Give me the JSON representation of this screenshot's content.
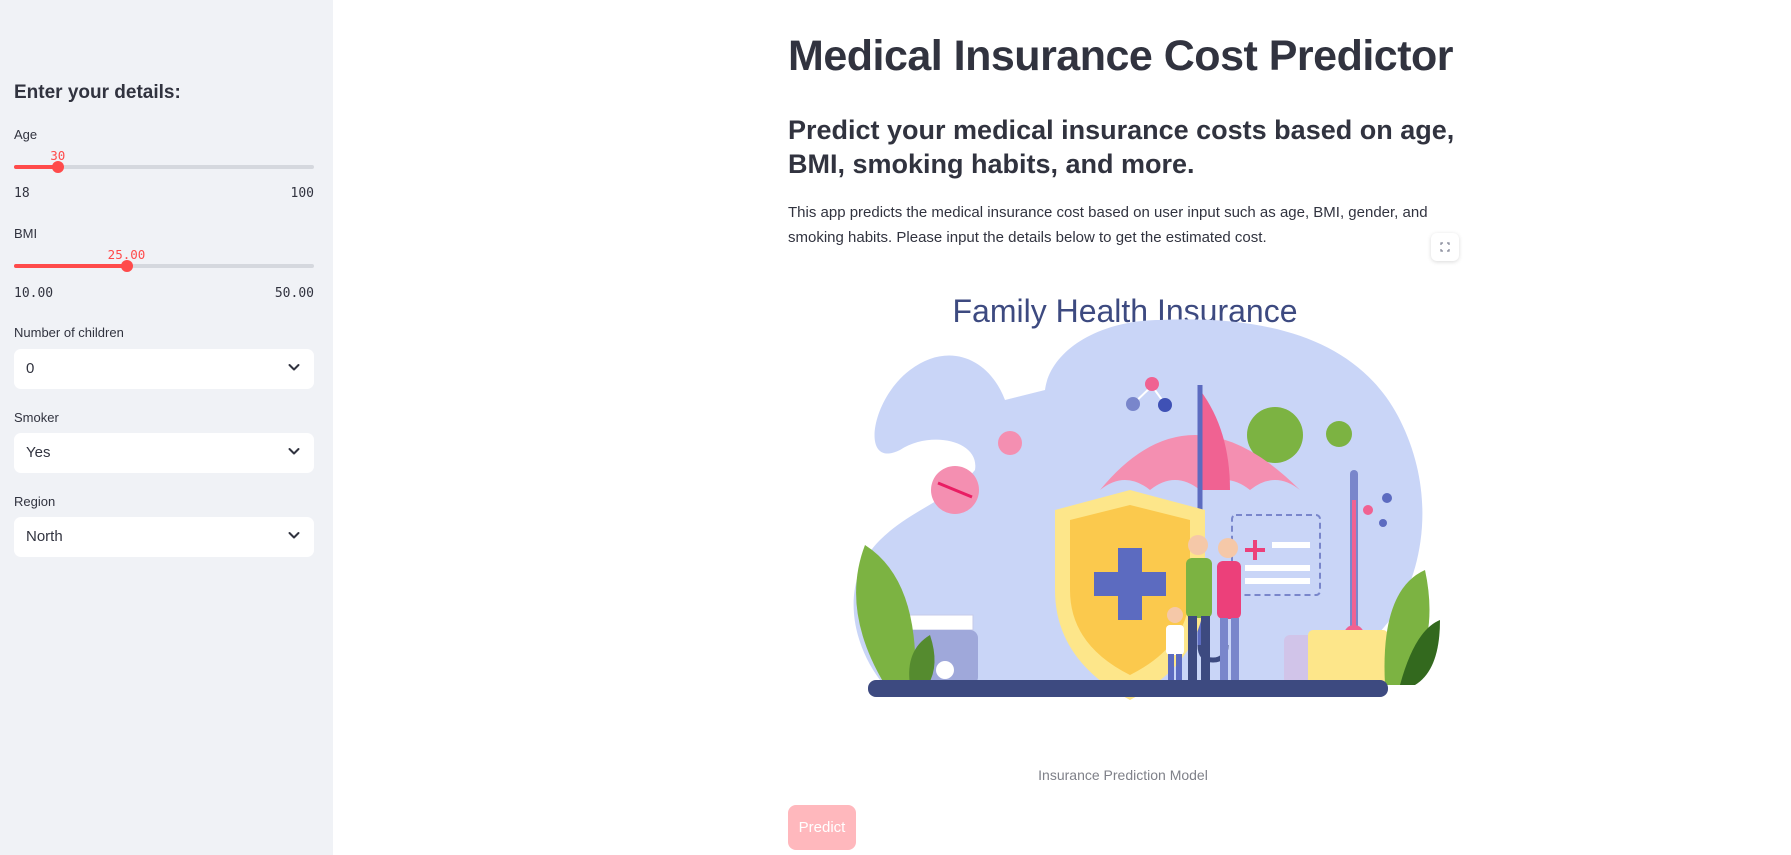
{
  "sidebar": {
    "title": "Enter your details:",
    "age": {
      "label": "Age",
      "value": "30",
      "min": "18",
      "max": "100",
      "fraction": 0.146
    },
    "bmi": {
      "label": "BMI",
      "value": "25.00",
      "min": "10.00",
      "max": "50.00",
      "fraction": 0.375
    },
    "children": {
      "label": "Number of children",
      "value": "0"
    },
    "smoker": {
      "label": "Smoker",
      "value": "Yes"
    },
    "region": {
      "label": "Region",
      "value": "North"
    }
  },
  "main": {
    "title": "Medical Insurance Cost Predictor",
    "subheading": "Predict your medical insurance costs based on age, BMI, smoking habits, and more.",
    "description": "This app predicts the medical insurance cost based on user input such as age, BMI, gender, and smoking habits. Please input the details below to get the estimated cost.",
    "image_title": "Family Health Insurance",
    "caption": "Insurance Prediction Model",
    "predict_label": "Predict"
  },
  "colors": {
    "accent": "#ff4b4b",
    "sidebar_bg": "#f0f2f6",
    "predict_bg": "#ffb8bd"
  }
}
